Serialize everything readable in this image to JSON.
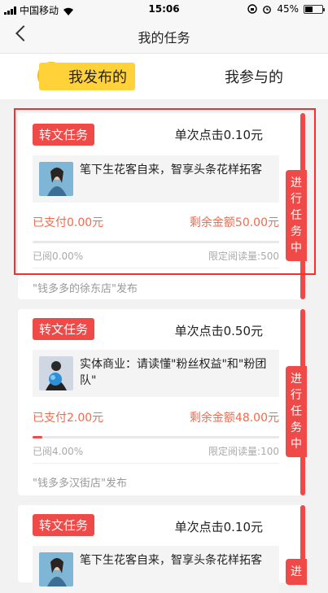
{
  "status_bar": {
    "carrier": "中国移动",
    "time": "15:06",
    "battery": "45%",
    "battery_level": 0.45
  },
  "nav": {
    "title": "我的任务"
  },
  "tabs": [
    {
      "label": "我发布的",
      "active": true
    },
    {
      "label": "我参与的",
      "active": false
    }
  ],
  "colors": {
    "accent": "#f04a48",
    "money": "#f26a4c",
    "tab_highlight": "#ffd23a"
  },
  "tasks": [
    {
      "badge": "转文任务",
      "price": "单次点击0.10元",
      "article_title": "笔下生花客自来，智享头条花样拓客",
      "paid": "已支付0.00元",
      "remaining": "剩余金额50.00元",
      "progress": 0,
      "read": "已阅0.00%",
      "limit": "限定阅读量:500",
      "publisher": "\"钱多多的徐东店\"发布",
      "status": "进行任务中"
    },
    {
      "badge": "转文任务",
      "price": "单次点击0.50元",
      "article_title": "实体商业：请读懂\"粉丝权益\"和\"粉团队\"",
      "paid": "已支付2.00元",
      "remaining": "剩余金额48.00元",
      "progress": 0.04,
      "read": "已阅4.00%",
      "limit": "限定阅读量:100",
      "publisher": "\"钱多多汉街店\"发布",
      "status": "进行任务中"
    },
    {
      "badge": "转文任务",
      "price": "单次点击0.10元",
      "article_title": "笔下生花客自来，智享头条花样拓客",
      "status": "进"
    }
  ]
}
